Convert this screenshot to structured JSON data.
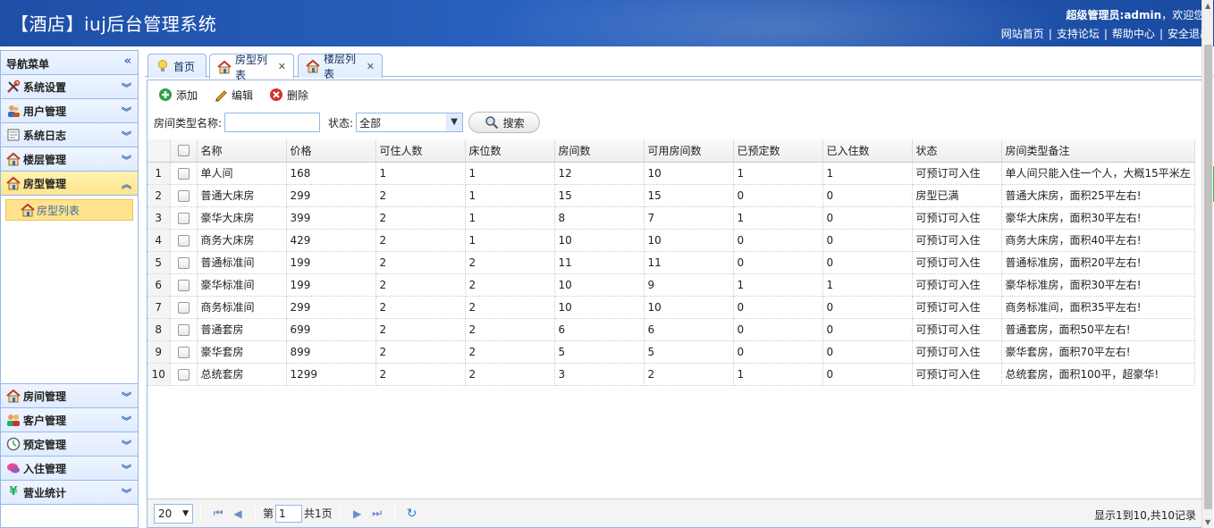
{
  "header": {
    "title": "【酒店】iuj后台管理系统",
    "welcome_prefix": "超级管理员:",
    "welcome_user": "admin",
    "welcome_suffix": "，欢迎您!",
    "links": [
      "网站首页",
      "支持论坛",
      "帮助中心",
      "安全退出"
    ]
  },
  "sidebar": {
    "title": "导航菜单",
    "items": [
      {
        "label": "系统设置",
        "icon": "tools-icon"
      },
      {
        "label": "用户管理",
        "icon": "users-icon"
      },
      {
        "label": "系统日志",
        "icon": "log-icon"
      },
      {
        "label": "楼层管理",
        "icon": "house-icon"
      },
      {
        "label": "房型管理",
        "icon": "house-icon",
        "active": true
      },
      {
        "label": "房间管理",
        "icon": "house-icon"
      },
      {
        "label": "客户管理",
        "icon": "customers-icon"
      },
      {
        "label": "预定管理",
        "icon": "clock-icon"
      },
      {
        "label": "入住管理",
        "icon": "chat-icon"
      },
      {
        "label": "营业统计",
        "icon": "yen-icon"
      }
    ],
    "sub_items": [
      "房型列表"
    ]
  },
  "tabs": [
    {
      "label": "首页",
      "icon": "bulb-icon"
    },
    {
      "label": "房型列表",
      "icon": "house-icon",
      "active": true
    },
    {
      "label": "楼层列表",
      "icon": "house-icon"
    }
  ],
  "toolbar": {
    "add": "添加",
    "edit": "编辑",
    "delete": "删除"
  },
  "search": {
    "name_label": "房间类型名称:",
    "name_value": "",
    "status_label": "状态:",
    "status_value": "全部",
    "button": "搜索"
  },
  "table": {
    "columns": [
      "名称",
      "价格",
      "可住人数",
      "床位数",
      "房间数",
      "可用房间数",
      "已预定数",
      "已入住数",
      "状态",
      "房间类型备注"
    ],
    "rows": [
      [
        "单人间",
        "168",
        "1",
        "1",
        "12",
        "10",
        "1",
        "1",
        "可预订可入住",
        "单人间只能入住一个人，大概15平米左"
      ],
      [
        "普通大床房",
        "299",
        "2",
        "1",
        "15",
        "15",
        "0",
        "0",
        "房型已满",
        "普通大床房，面积25平左右!"
      ],
      [
        "豪华大床房",
        "399",
        "2",
        "1",
        "8",
        "7",
        "1",
        "0",
        "可预订可入住",
        "豪华大床房，面积30平左右!"
      ],
      [
        "商务大床房",
        "429",
        "2",
        "1",
        "10",
        "10",
        "0",
        "0",
        "可预订可入住",
        "商务大床房，面积40平左右!"
      ],
      [
        "普通标准间",
        "199",
        "2",
        "2",
        "11",
        "11",
        "0",
        "0",
        "可预订可入住",
        "普通标准房，面积20平左右!"
      ],
      [
        "豪华标准间",
        "199",
        "2",
        "2",
        "10",
        "9",
        "1",
        "1",
        "可预订可入住",
        "豪华标准房，面积30平左右!"
      ],
      [
        "商务标准间",
        "299",
        "2",
        "2",
        "10",
        "10",
        "0",
        "0",
        "可预订可入住",
        "商务标准间，面积35平左右!"
      ],
      [
        "普通套房",
        "699",
        "2",
        "2",
        "6",
        "6",
        "0",
        "0",
        "可预订可入住",
        "普通套房，面积50平左右!"
      ],
      [
        "豪华套房",
        "899",
        "2",
        "2",
        "5",
        "5",
        "0",
        "0",
        "可预订可入住",
        "豪华套房，面积70平左右!"
      ],
      [
        "总统套房",
        "1299",
        "2",
        "2",
        "3",
        "2",
        "1",
        "0",
        "可预订可入住",
        "总统套房，面积100平，超豪华!"
      ]
    ]
  },
  "pager": {
    "page_size": "20",
    "page_prefix": "第",
    "page_value": "1",
    "page_suffix": "共1页",
    "info": "显示1到10,共10记录"
  }
}
